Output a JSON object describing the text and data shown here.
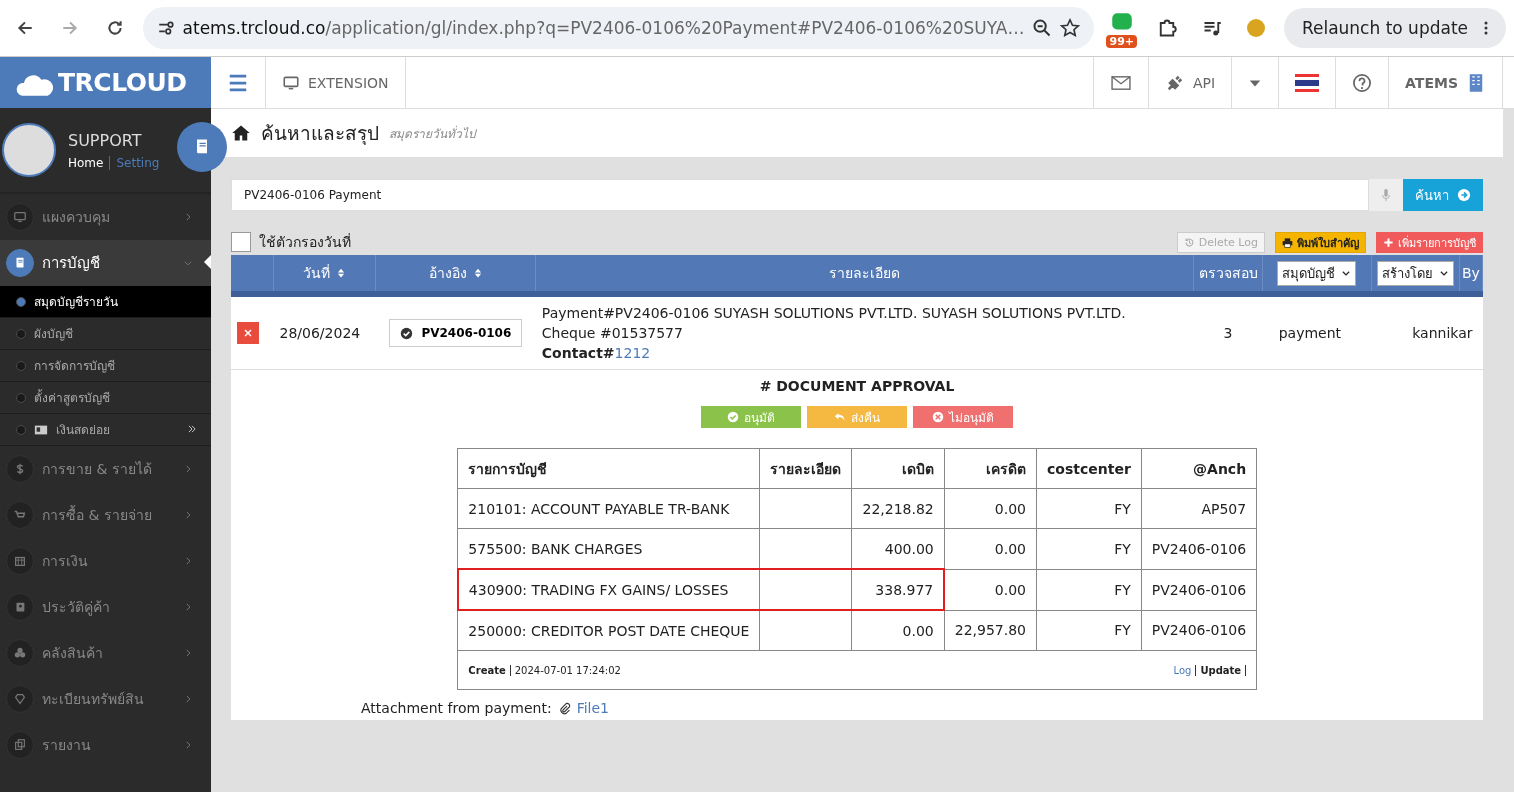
{
  "browser": {
    "url_host": "atems.trcloud.co",
    "url_path": "/application/gl/index.php?q=PV2406-0106%20Payment#PV2406-0106%20SUYA…",
    "extension_badge": "99+",
    "relaunch_label": "Relaunch to update"
  },
  "header": {
    "logo": "TRCLOUD",
    "extension_label": "EXTENSION",
    "api_label": "API",
    "company_label": "ATEMS"
  },
  "profile": {
    "name": "SUPPORT",
    "links": [
      {
        "label": "Home",
        "selected": true
      },
      {
        "label": "Setting",
        "selected": false
      }
    ]
  },
  "sidebar": {
    "items": [
      {
        "label": "แผงควบคุม",
        "selected": false,
        "expanded": false
      },
      {
        "label": "การบัญชี",
        "selected": true,
        "expanded": true,
        "children": [
          {
            "label": "สมุดบัญชีรายวัน",
            "selected": true,
            "kind": "link"
          },
          {
            "label": "ผังบัญชี",
            "selected": false,
            "kind": "link"
          },
          {
            "label": "การจัดการบัญชี",
            "selected": false,
            "kind": "link"
          },
          {
            "label": "ตั้งค่าสูตรบัญชี",
            "selected": false,
            "kind": "link"
          },
          {
            "label": "เงินสดย่อย",
            "selected": false,
            "kind": "submenu"
          }
        ]
      },
      {
        "label": "การขาย & รายได้",
        "selected": false,
        "expanded": false
      },
      {
        "label": "การซื้อ & รายจ่าย",
        "selected": false,
        "expanded": false
      },
      {
        "label": "การเงิน",
        "selected": false,
        "expanded": false
      },
      {
        "label": "ประวัติคู่ค้า",
        "selected": false,
        "expanded": false
      },
      {
        "label": "คลังสินค้า",
        "selected": false,
        "expanded": false
      },
      {
        "label": "ทะเบียนทรัพย์สิน",
        "selected": false,
        "expanded": false
      },
      {
        "label": "รายงาน",
        "selected": false,
        "expanded": false
      }
    ]
  },
  "page": {
    "title": "ค้นหาและสรุป",
    "subtitle": "สมุดรายวันทั่วไป"
  },
  "search": {
    "value": "PV2406-0106 Payment",
    "button": "ค้นหา"
  },
  "date_filter": {
    "label": "ใช้ตัวกรองวันที่",
    "checked": false
  },
  "toolbar": [
    {
      "label": "Delete Log",
      "kind": "default"
    },
    {
      "label": "พิมพ์ใบสำคัญ",
      "kind": "warning"
    },
    {
      "label": "เพิ่มรายการบัญชี",
      "kind": "danger"
    }
  ],
  "journal_table": {
    "columns": [
      {
        "label": "วันที่",
        "kind": "sort"
      },
      {
        "label": "อ้างอิง",
        "kind": "sort"
      },
      {
        "label": "รายละเอียด",
        "kind": "plain"
      },
      {
        "label": "ตรวจสอบ",
        "kind": "small"
      },
      {
        "label": "สมุดบัญชี",
        "kind": "select"
      },
      {
        "label": "สร้างโดย",
        "kind": "select"
      },
      {
        "label": "By",
        "kind": "plain"
      }
    ],
    "rows": [
      {
        "date": "28/06/2024",
        "reference": "PV2406-0106",
        "detail_lines": [
          "Payment#PV2406-0106 SUYASH SOLUTIONS PVT.LTD. SUYASH SOLUTIONS PVT.LTD.",
          "Cheque #01537577"
        ],
        "contact_label": "Contact#",
        "contact_link": "1212",
        "check": "3",
        "book": "payment",
        "by": "kannikar"
      }
    ]
  },
  "approval": {
    "title": "# DOCUMENT APPROVAL",
    "buttons": [
      {
        "label": "อนุมัติ",
        "kind": "approve"
      },
      {
        "label": "ส่งคืน",
        "kind": "return"
      },
      {
        "label": "ไม่อนุมัติ",
        "kind": "reject"
      }
    ]
  },
  "entries_table": {
    "columns": [
      "รายการบัญชี",
      "รายละเอียด",
      "เดบิต",
      "เครดิต",
      "costcenter",
      "@Anch"
    ],
    "rows": [
      {
        "account": "210101: ACCOUNT PAYABLE TR-BANK",
        "detail": "",
        "debit": "22,218.82",
        "credit": "0.00",
        "costcenter": "FY",
        "anch": "AP507",
        "highlighted": false
      },
      {
        "account": "575500: BANK CHARGES",
        "detail": "",
        "debit": "400.00",
        "credit": "0.00",
        "costcenter": "FY",
        "anch": "PV2406-0106",
        "highlighted": false
      },
      {
        "account": "430900: TRADING FX GAINS/ LOSSES",
        "detail": "",
        "debit": "338.977",
        "credit": "0.00",
        "costcenter": "FY",
        "anch": "PV2406-0106",
        "highlighted": true
      },
      {
        "account": "250000: CREDITOR POST DATE CHEQUE",
        "detail": "",
        "debit": "0.00",
        "credit": "22,957.80",
        "costcenter": "FY",
        "anch": "PV2406-0106",
        "highlighted": false
      }
    ],
    "footer": {
      "create_label": "Create",
      "created": "2024-07-01 17:24:02",
      "log_link": "Log",
      "update_label": "Update"
    }
  },
  "attachment": {
    "label": "Attachment from payment:",
    "file": "File1"
  }
}
